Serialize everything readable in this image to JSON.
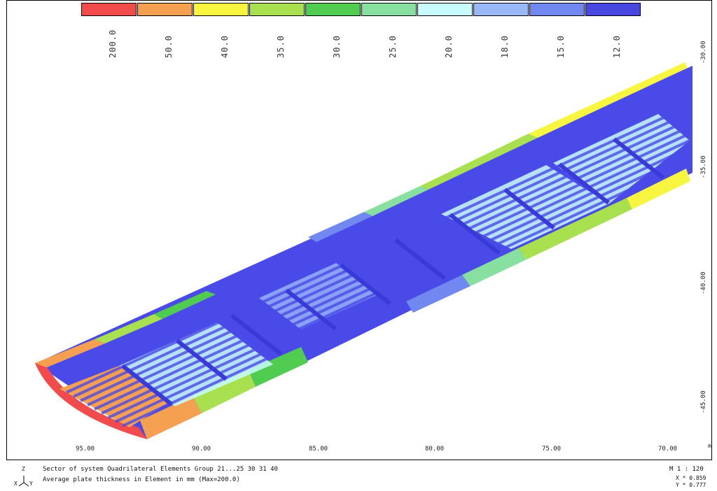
{
  "legend": {
    "items": [
      {
        "label": "200.0",
        "color": "#f24b4b"
      },
      {
        "label": "50.0",
        "color": "#f5a050"
      },
      {
        "label": "40.0",
        "color": "#f8f540"
      },
      {
        "label": "35.0",
        "color": "#a8e050"
      },
      {
        "label": "30.0",
        "color": "#50cc50"
      },
      {
        "label": "25.0",
        "color": "#88e0a0"
      },
      {
        "label": "20.0",
        "color": "#c8fcfc"
      },
      {
        "label": "18.0",
        "color": "#98b8f8"
      },
      {
        "label": "15.0",
        "color": "#7088f0"
      },
      {
        "label": "12.0",
        "color": "#4848e0"
      }
    ]
  },
  "x_axis": {
    "ticks": [
      "95.00",
      "90.00",
      "85.00",
      "80.00",
      "75.00",
      "70.00"
    ]
  },
  "y_axis": {
    "ticks": [
      "-30.00",
      "-35.00",
      "-40.00",
      "-45.00"
    ],
    "unit": "m"
  },
  "footer": {
    "line1": "Sector of system Quadrilateral Elements Group 21...25 30 31 40",
    "line2": "Average plate thickness in Element in mm (Max=200.0)",
    "scale": "M 1 : 120",
    "x_value": "X * 0.859",
    "y_value": "Y * 0.777"
  },
  "axes_icon": {
    "z": "Z",
    "x": "X",
    "y": "Y"
  }
}
